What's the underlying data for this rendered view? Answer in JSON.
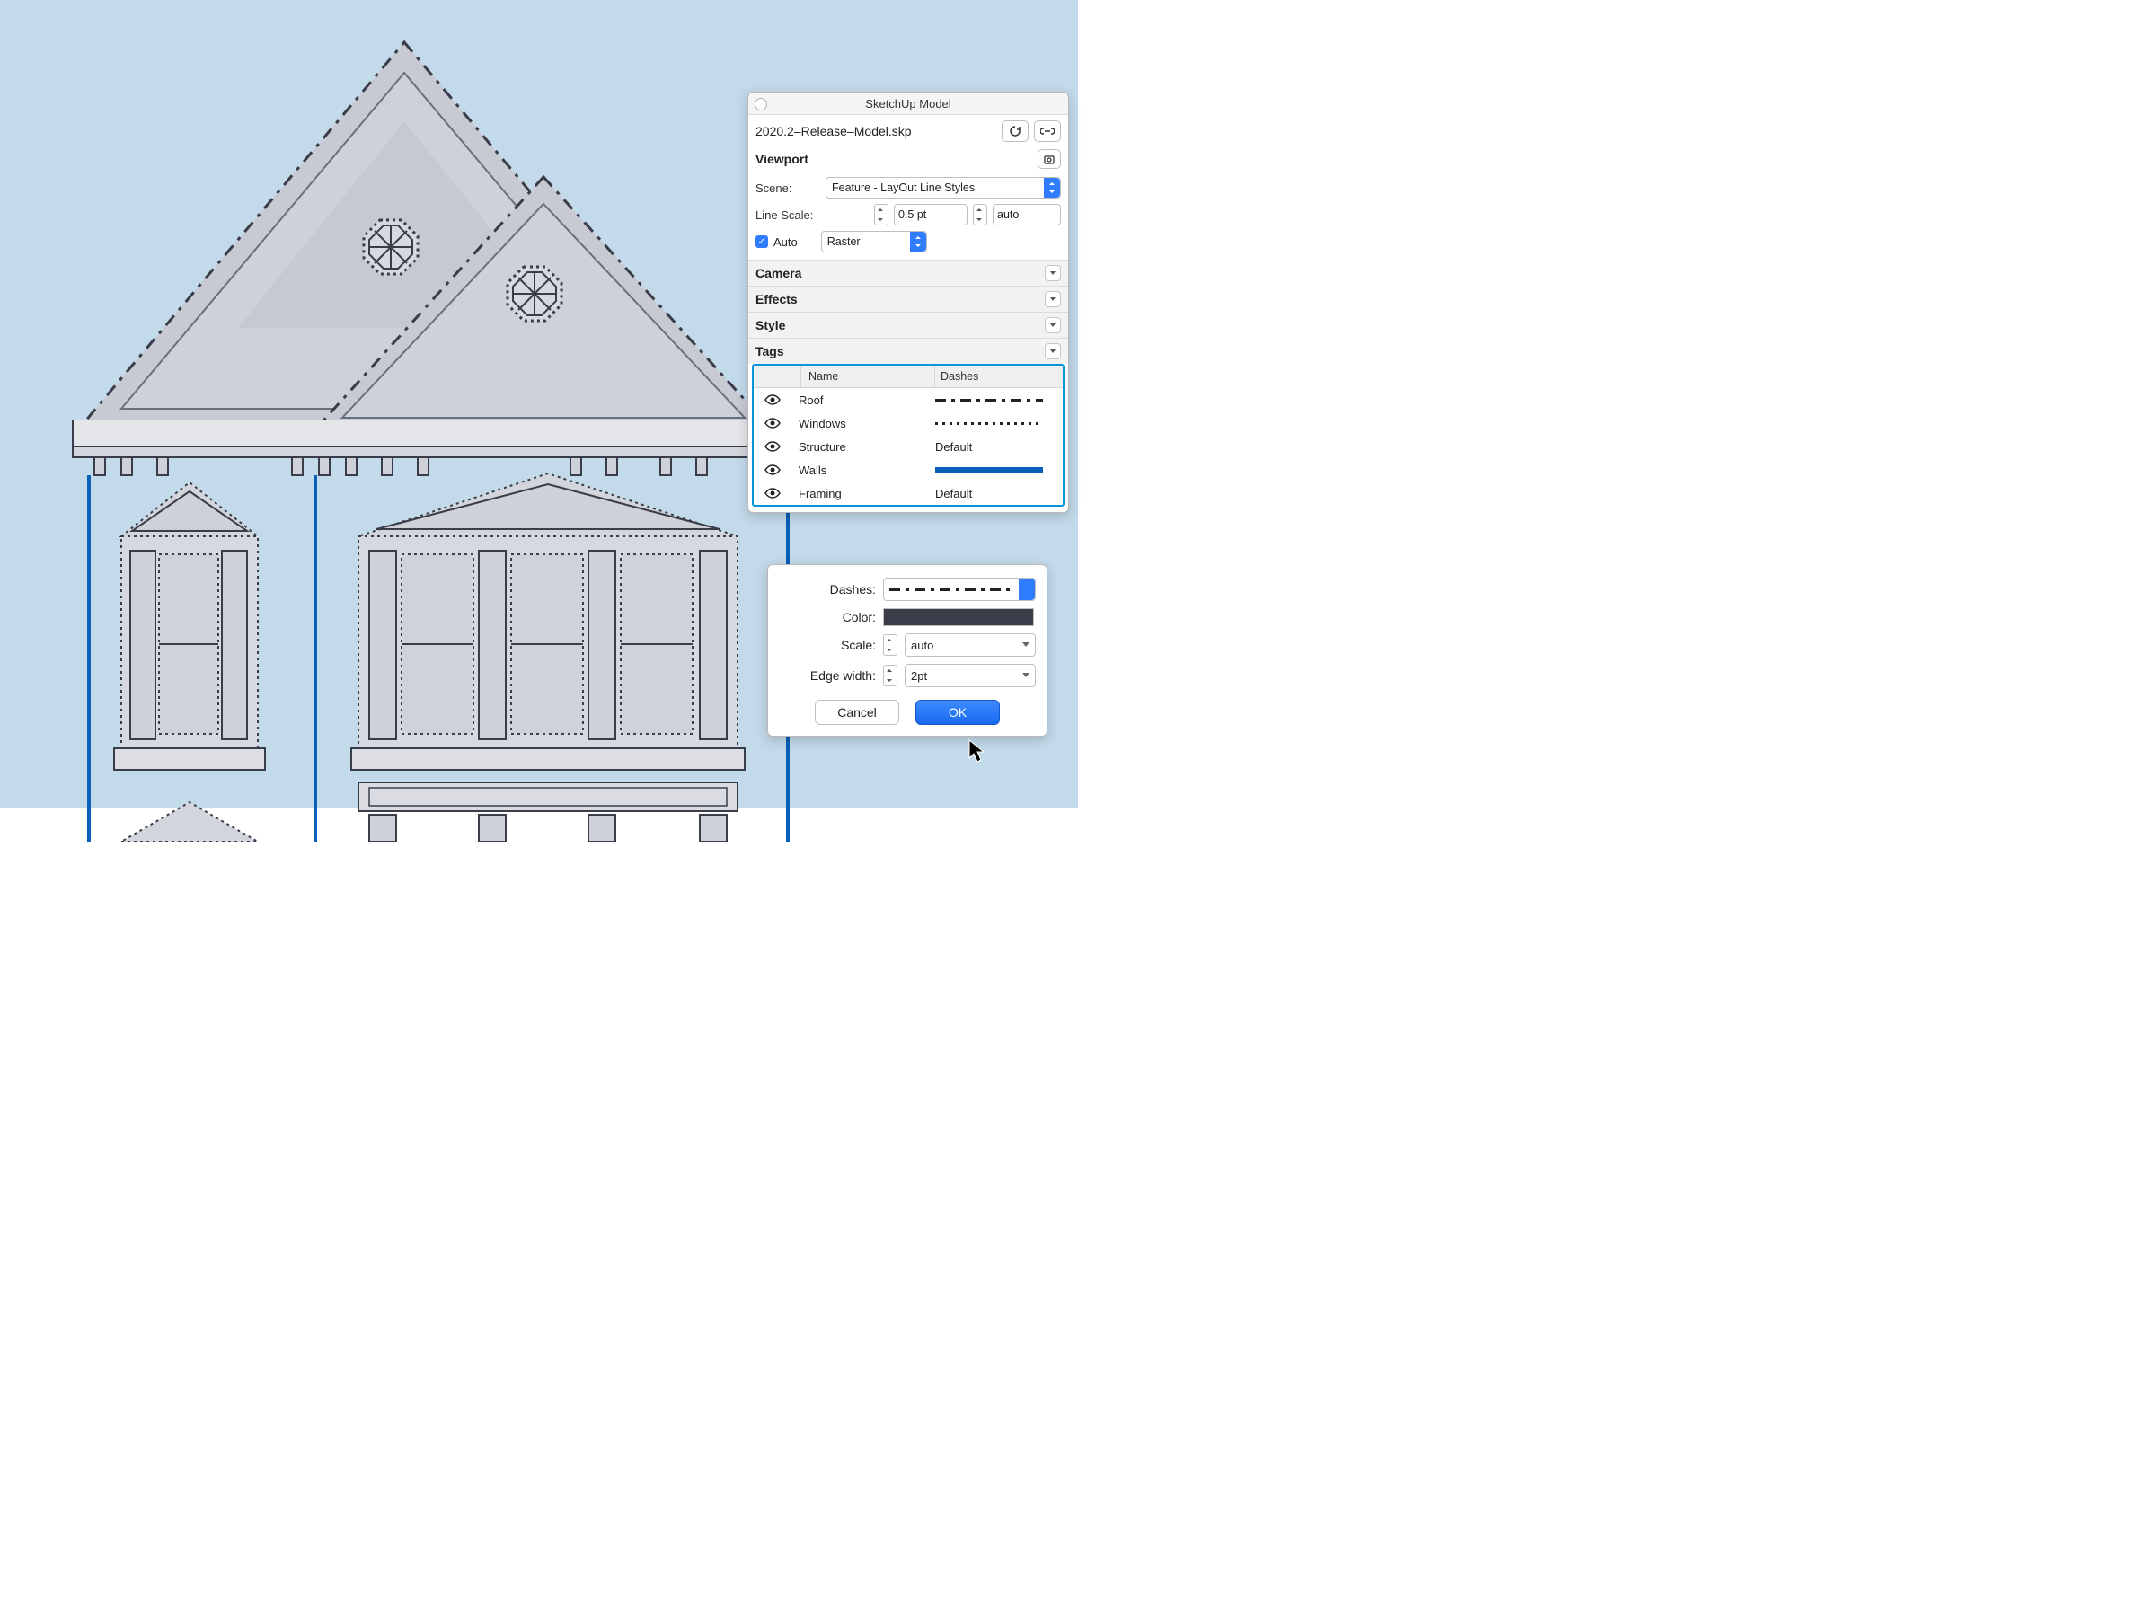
{
  "panel": {
    "title": "SketchUp Model",
    "filename": "2020.2–Release–Model.skp",
    "viewport_label": "Viewport",
    "scene_label": "Scene:",
    "scene_value": "Feature - LayOut Line Styles",
    "linescale_label": "Line Scale:",
    "linescale_value": "0.5 pt",
    "linescale_auto": "auto",
    "auto_label": "Auto",
    "raster_value": "Raster",
    "accordions": [
      "Camera",
      "Effects",
      "Style",
      "Tags"
    ],
    "tags_header": {
      "name": "Name",
      "dashes": "Dashes"
    },
    "tags": [
      {
        "name": "Roof",
        "dash": "roof"
      },
      {
        "name": "Windows",
        "dash": "windows"
      },
      {
        "name": "Structure",
        "dash": "Default"
      },
      {
        "name": "Walls",
        "dash": "walls"
      },
      {
        "name": "Framing",
        "dash": "Default"
      }
    ]
  },
  "dialog": {
    "dashes_label": "Dashes:",
    "color_label": "Color:",
    "scale_label": "Scale:",
    "scale_value": "auto",
    "edge_label": "Edge width:",
    "edge_value": "2pt",
    "cancel": "Cancel",
    "ok": "OK"
  }
}
